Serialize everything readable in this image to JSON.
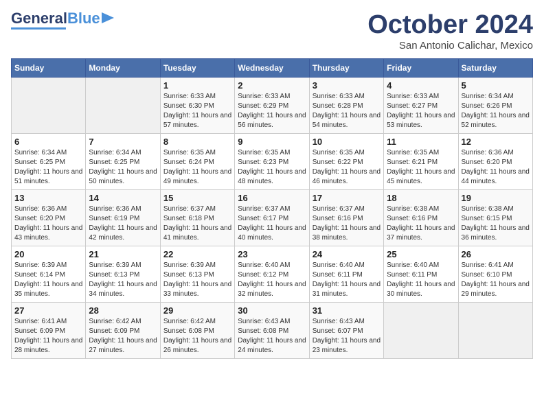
{
  "header": {
    "logo_line1": "General",
    "logo_line2": "Blue",
    "month_title": "October 2024",
    "location": "San Antonio Calichar, Mexico"
  },
  "weekdays": [
    "Sunday",
    "Monday",
    "Tuesday",
    "Wednesday",
    "Thursday",
    "Friday",
    "Saturday"
  ],
  "weeks": [
    [
      {
        "day": "",
        "info": ""
      },
      {
        "day": "",
        "info": ""
      },
      {
        "day": "1",
        "info": "Sunrise: 6:33 AM\nSunset: 6:30 PM\nDaylight: 11 hours and 57 minutes."
      },
      {
        "day": "2",
        "info": "Sunrise: 6:33 AM\nSunset: 6:29 PM\nDaylight: 11 hours and 56 minutes."
      },
      {
        "day": "3",
        "info": "Sunrise: 6:33 AM\nSunset: 6:28 PM\nDaylight: 11 hours and 54 minutes."
      },
      {
        "day": "4",
        "info": "Sunrise: 6:33 AM\nSunset: 6:27 PM\nDaylight: 11 hours and 53 minutes."
      },
      {
        "day": "5",
        "info": "Sunrise: 6:34 AM\nSunset: 6:26 PM\nDaylight: 11 hours and 52 minutes."
      }
    ],
    [
      {
        "day": "6",
        "info": "Sunrise: 6:34 AM\nSunset: 6:25 PM\nDaylight: 11 hours and 51 minutes."
      },
      {
        "day": "7",
        "info": "Sunrise: 6:34 AM\nSunset: 6:25 PM\nDaylight: 11 hours and 50 minutes."
      },
      {
        "day": "8",
        "info": "Sunrise: 6:35 AM\nSunset: 6:24 PM\nDaylight: 11 hours and 49 minutes."
      },
      {
        "day": "9",
        "info": "Sunrise: 6:35 AM\nSunset: 6:23 PM\nDaylight: 11 hours and 48 minutes."
      },
      {
        "day": "10",
        "info": "Sunrise: 6:35 AM\nSunset: 6:22 PM\nDaylight: 11 hours and 46 minutes."
      },
      {
        "day": "11",
        "info": "Sunrise: 6:35 AM\nSunset: 6:21 PM\nDaylight: 11 hours and 45 minutes."
      },
      {
        "day": "12",
        "info": "Sunrise: 6:36 AM\nSunset: 6:20 PM\nDaylight: 11 hours and 44 minutes."
      }
    ],
    [
      {
        "day": "13",
        "info": "Sunrise: 6:36 AM\nSunset: 6:20 PM\nDaylight: 11 hours and 43 minutes."
      },
      {
        "day": "14",
        "info": "Sunrise: 6:36 AM\nSunset: 6:19 PM\nDaylight: 11 hours and 42 minutes."
      },
      {
        "day": "15",
        "info": "Sunrise: 6:37 AM\nSunset: 6:18 PM\nDaylight: 11 hours and 41 minutes."
      },
      {
        "day": "16",
        "info": "Sunrise: 6:37 AM\nSunset: 6:17 PM\nDaylight: 11 hours and 40 minutes."
      },
      {
        "day": "17",
        "info": "Sunrise: 6:37 AM\nSunset: 6:16 PM\nDaylight: 11 hours and 38 minutes."
      },
      {
        "day": "18",
        "info": "Sunrise: 6:38 AM\nSunset: 6:16 PM\nDaylight: 11 hours and 37 minutes."
      },
      {
        "day": "19",
        "info": "Sunrise: 6:38 AM\nSunset: 6:15 PM\nDaylight: 11 hours and 36 minutes."
      }
    ],
    [
      {
        "day": "20",
        "info": "Sunrise: 6:39 AM\nSunset: 6:14 PM\nDaylight: 11 hours and 35 minutes."
      },
      {
        "day": "21",
        "info": "Sunrise: 6:39 AM\nSunset: 6:13 PM\nDaylight: 11 hours and 34 minutes."
      },
      {
        "day": "22",
        "info": "Sunrise: 6:39 AM\nSunset: 6:13 PM\nDaylight: 11 hours and 33 minutes."
      },
      {
        "day": "23",
        "info": "Sunrise: 6:40 AM\nSunset: 6:12 PM\nDaylight: 11 hours and 32 minutes."
      },
      {
        "day": "24",
        "info": "Sunrise: 6:40 AM\nSunset: 6:11 PM\nDaylight: 11 hours and 31 minutes."
      },
      {
        "day": "25",
        "info": "Sunrise: 6:40 AM\nSunset: 6:11 PM\nDaylight: 11 hours and 30 minutes."
      },
      {
        "day": "26",
        "info": "Sunrise: 6:41 AM\nSunset: 6:10 PM\nDaylight: 11 hours and 29 minutes."
      }
    ],
    [
      {
        "day": "27",
        "info": "Sunrise: 6:41 AM\nSunset: 6:09 PM\nDaylight: 11 hours and 28 minutes."
      },
      {
        "day": "28",
        "info": "Sunrise: 6:42 AM\nSunset: 6:09 PM\nDaylight: 11 hours and 27 minutes."
      },
      {
        "day": "29",
        "info": "Sunrise: 6:42 AM\nSunset: 6:08 PM\nDaylight: 11 hours and 26 minutes."
      },
      {
        "day": "30",
        "info": "Sunrise: 6:43 AM\nSunset: 6:08 PM\nDaylight: 11 hours and 24 minutes."
      },
      {
        "day": "31",
        "info": "Sunrise: 6:43 AM\nSunset: 6:07 PM\nDaylight: 11 hours and 23 minutes."
      },
      {
        "day": "",
        "info": ""
      },
      {
        "day": "",
        "info": ""
      }
    ]
  ]
}
